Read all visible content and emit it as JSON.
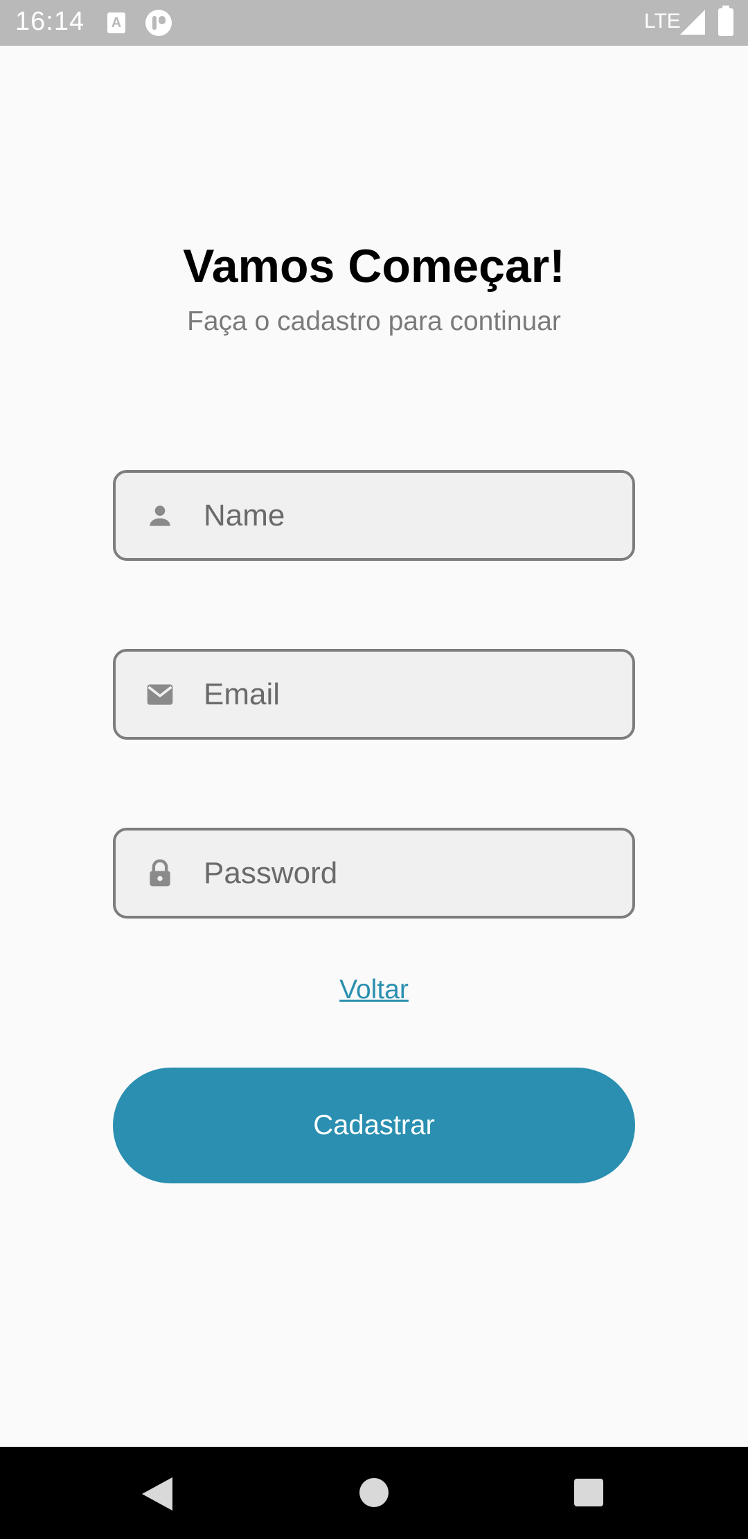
{
  "status_bar": {
    "time": "16:14",
    "network": "LTE",
    "icons": [
      "a-notification-icon",
      "app-notification-icon",
      "signal-icon",
      "battery-icon"
    ]
  },
  "header": {
    "title": "Vamos Começar!",
    "subtitle": "Faça o cadastro para continuar"
  },
  "form": {
    "name_placeholder": "Name",
    "name_icon": "person-icon",
    "email_placeholder": "Email",
    "email_icon": "mail-icon",
    "password_placeholder": "Password",
    "password_icon": "lock-icon",
    "back_link": "Voltar",
    "submit_label": "Cadastrar"
  },
  "nav_bar": {
    "icons": [
      "back-icon",
      "home-icon",
      "recents-icon"
    ]
  },
  "colors": {
    "accent": "#2a8fb0",
    "background": "#fafafa",
    "field_background": "#f0f0f0",
    "field_border": "#7d7d7d",
    "status_bar": "#b9b9b9"
  }
}
